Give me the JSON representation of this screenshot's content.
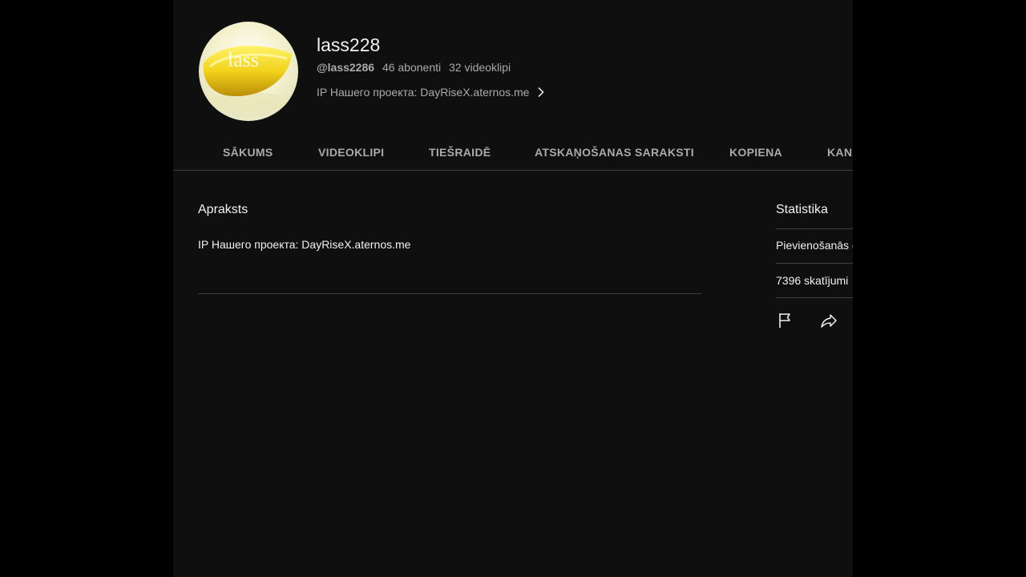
{
  "channel": {
    "name": "lass228",
    "handle": "@lass2286",
    "subscribers": "46 abonenti",
    "videos": "32 videoklipi",
    "short_description": "IP Нашего проекта: DayRiseX.aternos.me",
    "avatar_text": "lass"
  },
  "tabs": [
    {
      "label": "SĀKUMS"
    },
    {
      "label": "VIDEOKLIPI"
    },
    {
      "label": "TIEŠRAIDĒ"
    },
    {
      "label": "ATSKAŅOŠANAS SARAKSTI"
    },
    {
      "label": "KOPIENA"
    },
    {
      "label": "KANĀLI"
    }
  ],
  "about": {
    "title": "Apraksts",
    "text": "IP Нашего проекта: DayRiseX.aternos.me"
  },
  "stats": {
    "title": "Statistika",
    "joined": "Pievienošanās datums",
    "views": "7396 skatījumi"
  },
  "icons": {
    "flag": "flag-icon",
    "share": "share-icon",
    "chevron": "chevron-right-icon"
  }
}
